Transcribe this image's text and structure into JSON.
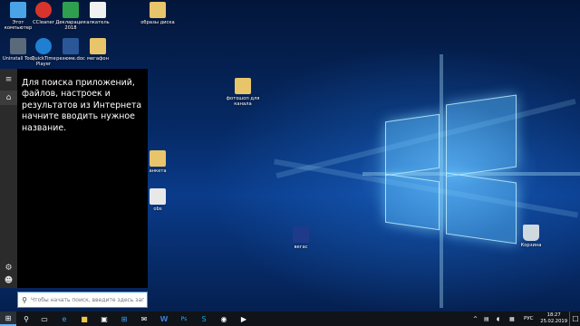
{
  "desktop_icons": [
    {
      "id": "this-pc",
      "label": "Этот компьютер",
      "color": "#4aa3e6"
    },
    {
      "id": "ccleaner",
      "label": "CCleaner",
      "color": "#d9342b"
    },
    {
      "id": "declaration",
      "label": "Декларация 2018",
      "color": "#2e9e4f"
    },
    {
      "id": "alkatel",
      "label": "алкатель",
      "color": "#f0f0f0"
    },
    {
      "id": "disk-images",
      "label": "образы диска",
      "color": "#e8c56a"
    },
    {
      "id": "uninstall-tool",
      "label": "Uninstall Tool",
      "color": "#5a6a7a"
    },
    {
      "id": "quicktime",
      "label": "QuickTime Player",
      "color": "#1f7fd1"
    },
    {
      "id": "resume",
      "label": "резюме.doc",
      "color": "#2b5797"
    },
    {
      "id": "megaphone",
      "label": "мегафон",
      "color": "#e8c56a"
    },
    {
      "id": "photoshop",
      "label": "фотошоп для канала",
      "color": "#e8c56a"
    },
    {
      "id": "anketa",
      "label": "анкета",
      "color": "#e8c56a"
    },
    {
      "id": "obs",
      "label": "obs",
      "color": "#e8e8e8"
    },
    {
      "id": "vegas",
      "label": "вегас",
      "color": "#1f3a8a"
    },
    {
      "id": "recycle-bin",
      "label": "Корзина",
      "color": "#d0d8e0"
    }
  ],
  "start_menu": {
    "message": "Для поиска приложений, файлов, настроек и результатов из Интернета начните вводить нужное название.",
    "rail": {
      "menu_icon": "hamburger-icon",
      "home_icon": "home-icon",
      "settings_icon": "gear-icon",
      "user_icon": "user-icon"
    }
  },
  "search": {
    "placeholder": "Чтобы начать поиск, введите здесь запрос"
  },
  "taskbar": {
    "apps": [
      {
        "name": "task-view-icon",
        "glyph": "▭"
      },
      {
        "name": "edge-icon",
        "glyph": "e"
      },
      {
        "name": "explorer-icon",
        "glyph": "■"
      },
      {
        "name": "store-icon",
        "glyph": "▣"
      },
      {
        "name": "windows-icon",
        "glyph": "⊞"
      },
      {
        "name": "mail-icon",
        "glyph": "✉"
      },
      {
        "name": "word-icon",
        "glyph": "W"
      },
      {
        "name": "photoshop-icon",
        "glyph": "Ps"
      },
      {
        "name": "skype-icon",
        "glyph": "S"
      },
      {
        "name": "media-icon",
        "glyph": "◉"
      },
      {
        "name": "clock-app-icon",
        "glyph": "◔"
      },
      {
        "name": "obs-icon",
        "glyph": "◎"
      },
      {
        "name": "video-icon",
        "glyph": "▶"
      }
    ],
    "tray": {
      "up_arrow": "^",
      "language": "РУС",
      "time": "18:27",
      "date": "25.02.2019"
    }
  },
  "colors": {
    "accent": "#4a90d9",
    "taskbar": "#101418",
    "start_bg": "#000000"
  }
}
